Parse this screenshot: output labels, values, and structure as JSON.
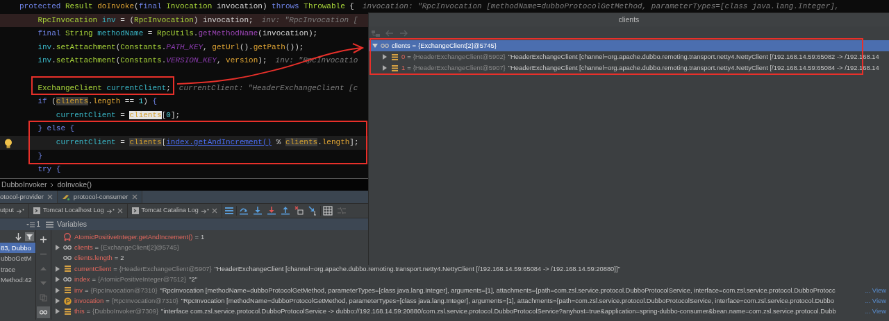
{
  "editor": {
    "lines": [
      {
        "tokens": [
          {
            "kind": "kw",
            "t": "protected "
          },
          {
            "kind": "type",
            "t": "Result "
          },
          {
            "kind": "decl",
            "t": "doInvoke"
          },
          {
            "kind": "plain",
            "t": "("
          },
          {
            "kind": "kw",
            "t": "final "
          },
          {
            "kind": "type",
            "t": "Invocation "
          },
          {
            "kind": "plain",
            "t": "invocation) "
          },
          {
            "kind": "kw",
            "t": "throws "
          },
          {
            "kind": "type",
            "t": "Throwable "
          },
          {
            "kind": "plain",
            "t": "{"
          }
        ],
        "hint": "invocation: \"RpcInvocation [methodName=dubboProtocolGetMethod, parameterTypes=[class java.lang.Integer],",
        "children": [
          {
            "kind": "breakpoint",
            "tokens": [
              {
                "kind": "type",
                "t": "RpcInvocation "
              },
              {
                "kind": "local",
                "t": "inv"
              },
              {
                "kind": "plain",
                "t": " = ("
              },
              {
                "kind": "type",
                "t": "RpcInvocation"
              },
              {
                "kind": "plain",
                "t": ") invocation;"
              }
            ],
            "hint": "inv: \"RpcInvocation ["
          },
          {
            "tokens": [
              {
                "kind": "kw",
                "t": "final "
              },
              {
                "kind": "type",
                "t": "String "
              },
              {
                "kind": "local",
                "t": "methodName"
              },
              {
                "kind": "plain",
                "t": " = "
              },
              {
                "kind": "type",
                "t": "RpcUtils"
              },
              {
                "kind": "plain",
                "t": "."
              },
              {
                "kind": "static",
                "t": "getMethodName"
              },
              {
                "kind": "plain",
                "t": "(invocation);"
              }
            ]
          },
          {
            "tokens": [
              {
                "kind": "local",
                "t": "inv"
              },
              {
                "kind": "plain",
                "t": "."
              },
              {
                "kind": "type",
                "t": "setAttachment"
              },
              {
                "kind": "plain",
                "t": "("
              },
              {
                "kind": "type",
                "t": "Constants"
              },
              {
                "kind": "plain",
                "t": "."
              },
              {
                "kind": "const",
                "t": "PATH_KEY"
              },
              {
                "kind": "plain",
                "t": ", "
              },
              {
                "kind": "decl",
                "t": "getUrl"
              },
              {
                "kind": "plain",
                "t": "()."
              },
              {
                "kind": "decl",
                "t": "getPath"
              },
              {
                "kind": "plain",
                "t": "());"
              }
            ]
          },
          {
            "tokens": [
              {
                "kind": "local",
                "t": "inv"
              },
              {
                "kind": "plain",
                "t": "."
              },
              {
                "kind": "type",
                "t": "setAttachment"
              },
              {
                "kind": "plain",
                "t": "("
              },
              {
                "kind": "type",
                "t": "Constants"
              },
              {
                "kind": "plain",
                "t": "."
              },
              {
                "kind": "const",
                "t": "VERSION_KEY"
              },
              {
                "kind": "plain",
                "t": ", "
              },
              {
                "kind": "decl",
                "t": "version"
              },
              {
                "kind": "plain",
                "t": ");"
              }
            ],
            "hint": "inv: \"RpcInvocatio"
          },
          {
            "kind": "blank"
          },
          {
            "tokens": [
              {
                "kind": "type",
                "t": "ExchangeClient "
              },
              {
                "kind": "local",
                "t": "currentClient"
              },
              {
                "kind": "plain",
                "t": ";"
              }
            ],
            "hint": "currentClient: \"HeaderExchangeClient [c"
          },
          {
            "tokens": [
              {
                "kind": "kw",
                "t": "if "
              },
              {
                "kind": "plain",
                "t": "("
              },
              {
                "kind": "field",
                "t": "clients"
              },
              {
                "kind": "plain",
                "t": "."
              },
              {
                "kind": "decl",
                "t": "length"
              },
              {
                "kind": "plain",
                "t": " == "
              },
              {
                "kind": "num",
                "t": "1"
              },
              {
                "kind": "plain",
                "t": ") "
              },
              {
                "kind": "kw",
                "t": "{"
              }
            ],
            "children": [
              {
                "tokens": [
                  {
                    "kind": "local",
                    "t": "currentClient"
                  },
                  {
                    "kind": "plain",
                    "t": " = "
                  },
                  {
                    "kind": "fieldsel",
                    "t": "clients"
                  },
                  {
                    "kind": "plain",
                    "t": "["
                  },
                  {
                    "kind": "num",
                    "t": "0"
                  },
                  {
                    "kind": "plain",
                    "t": "];"
                  }
                ]
              }
            ]
          },
          {
            "tokens": [
              {
                "kind": "kw",
                "t": "} else {"
              }
            ],
            "children": [
              {
                "kind": "caret",
                "bulb": true,
                "tokens": [
                  {
                    "kind": "local",
                    "t": "currentClient"
                  },
                  {
                    "kind": "plain",
                    "t": " = "
                  },
                  {
                    "kind": "field",
                    "t": "clients"
                  },
                  {
                    "kind": "plain",
                    "t": "["
                  },
                  {
                    "kind": "link",
                    "t": "index.getAndIncrement()"
                  },
                  {
                    "kind": "plain",
                    "t": " % "
                  },
                  {
                    "kind": "field",
                    "t": "clients"
                  },
                  {
                    "kind": "plain",
                    "t": "."
                  },
                  {
                    "kind": "decl",
                    "t": "length"
                  },
                  {
                    "kind": "plain",
                    "t": "];"
                  }
                ]
              }
            ]
          },
          {
            "tokens": [
              {
                "kind": "kw",
                "t": "}"
              }
            ]
          },
          {
            "tokens": [
              {
                "kind": "kw",
                "t": "try {"
              }
            ]
          }
        ]
      }
    ]
  },
  "popup": {
    "title": "clients",
    "tree": [
      {
        "name": "clients",
        "op": "=",
        "type": "{ExchangeClient[2]@5745}",
        "kind": "watch",
        "expanded": true,
        "selected": true,
        "children": [
          {
            "name": "0",
            "op": "=",
            "type": "{HeaderExchangeClient@5902}",
            "value": "\"HeaderExchangeClient [channel=org.apache.dubbo.remoting.transport.netty4.NettyClient [/192.168.14.59:65082 -> /192.168.14",
            "kind": "field",
            "expanded": false,
            "selected": false
          },
          {
            "name": "1",
            "op": "=",
            "type": "{HeaderExchangeClient@5907}",
            "value": "\"HeaderExchangeClient [channel=org.apache.dubbo.remoting.transport.netty4.NettyClient [/192.168.14.59:65084 -> /192.168.14",
            "kind": "field",
            "expanded": false,
            "selected": false
          }
        ]
      }
    ]
  },
  "breadcrumb": [
    "DubboInvoker",
    "doInvoke()"
  ],
  "session_tabs": [
    {
      "label": "otocol-provider",
      "selected": false
    },
    {
      "label": "protocol-consumer",
      "selected": true
    }
  ],
  "log_tabs": [
    {
      "label": "utput",
      "closable": false
    },
    {
      "label": "Tomcat Localhost Log",
      "closable": true
    },
    {
      "label": "Tomcat Catalina Log",
      "closable": true
    }
  ],
  "variables_header": {
    "thread_count": "1",
    "title": "Variables"
  },
  "frames": [
    {
      "label": "83, Dubbo",
      "selected": true
    },
    {
      "label": "ubboGetM",
      "selected": false
    },
    {
      "label": "trace",
      "selected": false
    },
    {
      "label": "Method:42",
      "selected": false
    }
  ],
  "variables": [
    {
      "kind": "return",
      "name": "AtomicPositiveInteger.getAndIncrement()",
      "op": "=",
      "value": "1",
      "expandable": false
    },
    {
      "kind": "watch",
      "name": "clients",
      "op": "=",
      "type": "{ExchangeClient[2]@5745}",
      "expandable": true
    },
    {
      "kind": "watch",
      "name": "clients.length",
      "op": "=",
      "value": "2",
      "expandable": false
    },
    {
      "kind": "field",
      "name": "currentClient",
      "op": "=",
      "type": "{HeaderExchangeClient@5907}",
      "value": "\"HeaderExchangeClient [channel=org.apache.dubbo.remoting.transport.netty4.NettyClient [/192.168.14.59:65084 -> /192.168.14.59:20880]]\"",
      "expandable": true
    },
    {
      "kind": "watch",
      "name": "index",
      "op": "=",
      "type": "{AtomicPositiveInteger@7512}",
      "value": "\"2\"",
      "expandable": true
    },
    {
      "kind": "field",
      "name": "inv",
      "op": "=",
      "type": "{RpcInvocation@7310}",
      "value": "\"RpcInvocation [methodName=dubboProtocolGetMethod, parameterTypes=[class java.lang.Integer], arguments=[1], attachments={path=com.zsl.service.protocol.DubboProtocolService, interface=com.zsl.service.protocol.DubboProtocc",
      "link": "... View",
      "expandable": true
    },
    {
      "kind": "param",
      "name": "invocation",
      "op": "=",
      "type": "{RpcInvocation@7310}",
      "value": "\"RpcInvocation [methodName=dubboProtocolGetMethod, parameterTypes=[class java.lang.Integer], arguments=[1], attachments={path=com.zsl.service.protocol.DubboProtocolService, interface=com.zsl.service.protocol.Dubbo",
      "link": "... View",
      "expandable": true
    },
    {
      "kind": "field",
      "name": "this",
      "op": "=",
      "type": "{DubboInvoker@7309}",
      "value": "\"interface com.zsl.service.protocol.DubboProtocolService -> dubbo://192.168.14.59:20880/com.zsl.service.protocol.DubboProtocolService?anyhost=true&application=spring-dubbo-consumer&bean.name=com.zsl.service.protocol.Dubb",
      "link": "... View",
      "expandable": true
    }
  ]
}
